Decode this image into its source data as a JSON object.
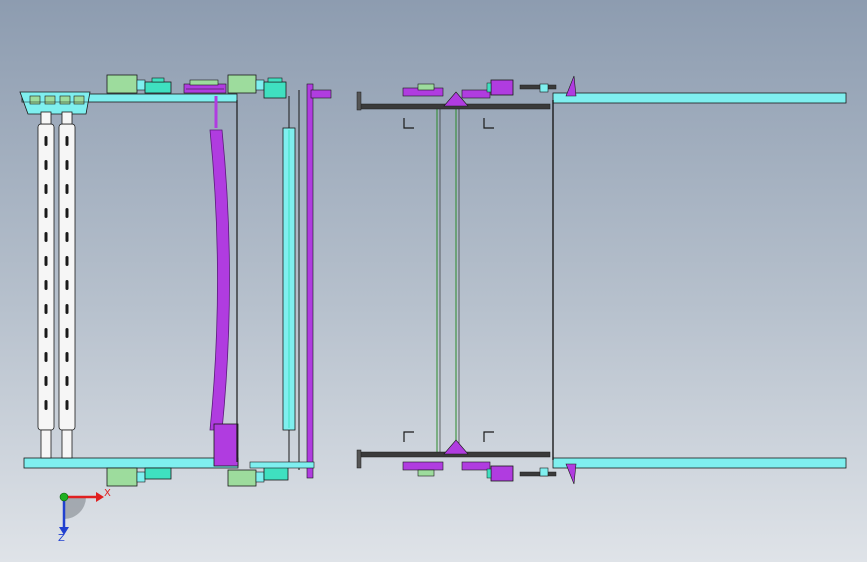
{
  "triad": {
    "x_label": "X",
    "z_label": "Z",
    "x_color": "#e02020",
    "y_color": "#20b020",
    "z_color": "#2040d0"
  },
  "colors": {
    "frame_cyan": "#7fefef",
    "motor_green": "#9ddc9d",
    "motor_cyan": "#3fe0c0",
    "roller_purple": "#b03ce0",
    "outline": "#1a1a1a",
    "roller_white": "#f6f6f6"
  }
}
